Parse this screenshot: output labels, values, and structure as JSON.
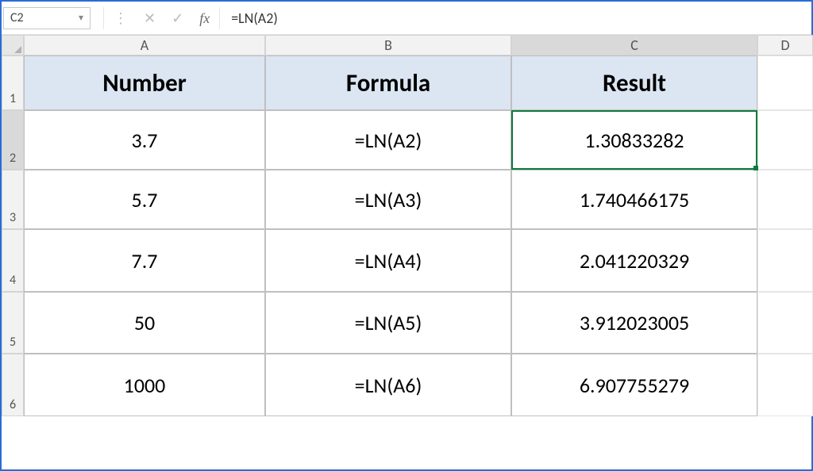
{
  "formula_bar": {
    "name_box": "C2",
    "fx_label": "fx",
    "formula": "=LN(A2)"
  },
  "columns": [
    "A",
    "B",
    "C",
    "D"
  ],
  "rows": [
    "1",
    "2",
    "3",
    "4",
    "5",
    "6"
  ],
  "active_column_index": 2,
  "active_row_index": 1,
  "table": {
    "headers": [
      "Number",
      "Formula",
      "Result"
    ],
    "rows": [
      {
        "number": "3.7",
        "formula": "=LN(A2)",
        "result": "1.30833282"
      },
      {
        "number": "5.7",
        "formula": "=LN(A3)",
        "result": "1.740466175"
      },
      {
        "number": "7.7",
        "formula": "=LN(A4)",
        "result": "2.041220329"
      },
      {
        "number": "50",
        "formula": "=LN(A5)",
        "result": "3.912023005"
      },
      {
        "number": "1000",
        "formula": "=LN(A6)",
        "result": "6.907755279"
      }
    ]
  },
  "selected_cell": {
    "col": "C",
    "row": "2"
  }
}
